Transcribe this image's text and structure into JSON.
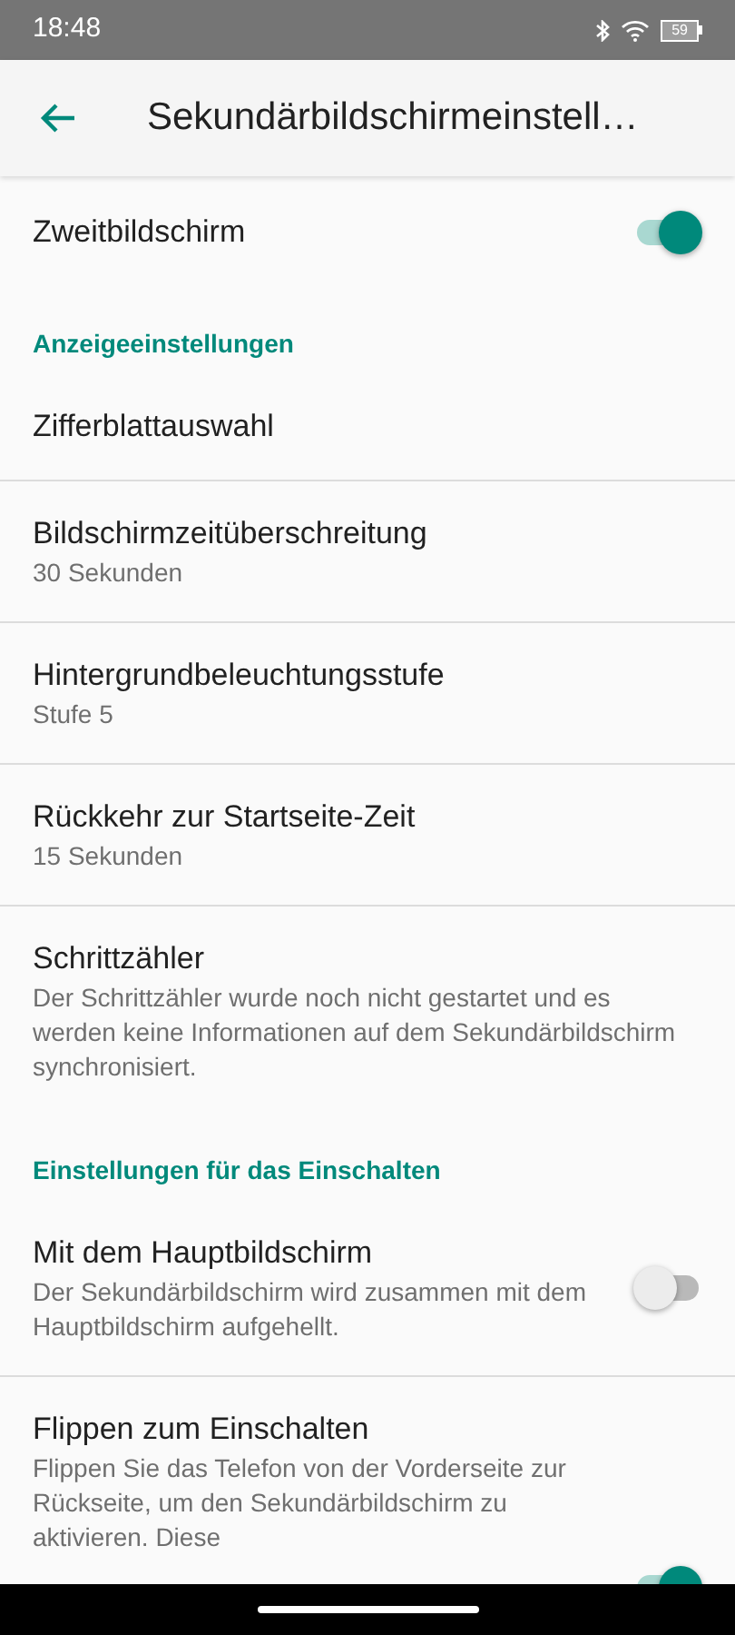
{
  "status_bar": {
    "time": "18:48",
    "battery": "59"
  },
  "app_bar": {
    "title": "Sekundärbildschirmeinstell…"
  },
  "items": [
    {
      "kind": "switch",
      "title": "Zweitbildschirm",
      "on": true
    },
    {
      "kind": "header",
      "title": "Anzeigeeinstellungen"
    },
    {
      "kind": "item",
      "title": "Zifferblattauswahl"
    },
    {
      "kind": "item",
      "title": "Bildschirmzeitüberschreitung",
      "summary": "30 Sekunden"
    },
    {
      "kind": "item",
      "title": "Hintergrundbeleuchtungsstufe",
      "summary": "Stufe 5"
    },
    {
      "kind": "item",
      "title": "Rückkehr zur Startseite-Zeit",
      "summary": "15 Sekunden"
    },
    {
      "kind": "item",
      "title": "Schrittzähler",
      "summary": "Der Schrittzähler wurde noch nicht gestartet und es werden keine Informationen auf dem Sekundärbildschirm synchronisiert."
    },
    {
      "kind": "header",
      "title": "Einstellungen für das Einschalten"
    },
    {
      "kind": "switch",
      "title": "Mit dem Hauptbildschirm",
      "summary": "Der Sekundärbildschirm wird zusammen mit dem Hauptbildschirm aufgehellt.",
      "on": false
    },
    {
      "kind": "switch",
      "title": "Flippen zum Einschalten",
      "summary": "Flippen Sie das Telefon von der Vorderseite zur Rückseite, um den Sekundärbildschirm zu aktivieren. Diese",
      "on": true
    }
  ]
}
